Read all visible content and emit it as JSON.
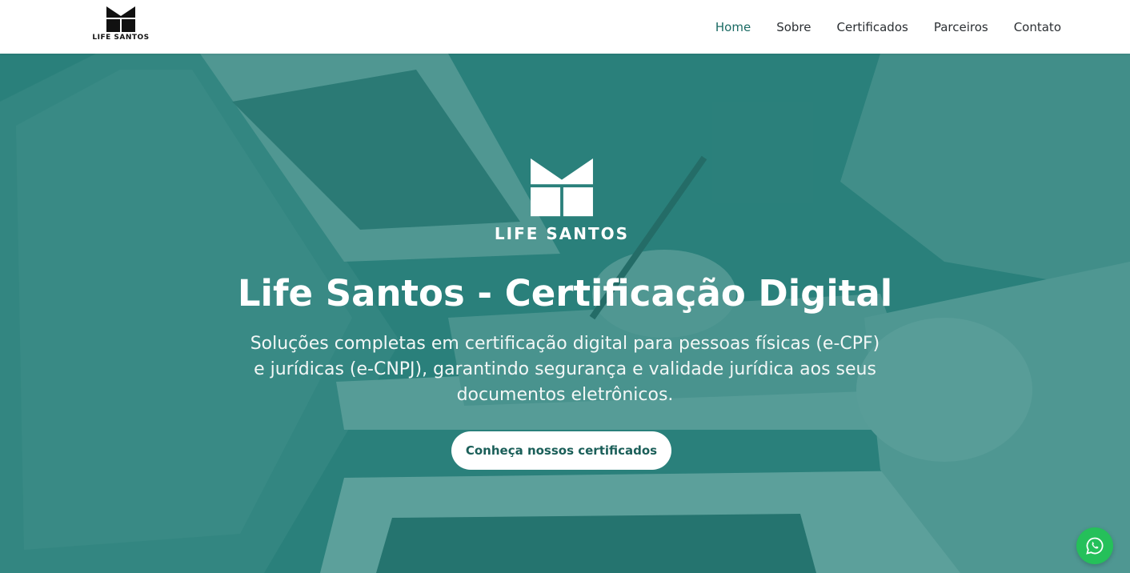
{
  "header": {
    "logo_text": "LIFE SANTOS",
    "nav": [
      {
        "label": "Home",
        "active": true
      },
      {
        "label": "Sobre",
        "active": false
      },
      {
        "label": "Certificados",
        "active": false
      },
      {
        "label": "Parceiros",
        "active": false
      },
      {
        "label": "Contato",
        "active": false
      }
    ]
  },
  "hero": {
    "logo_text": "LIFE SANTOS",
    "title": "Life Santos - Certificação Digital",
    "subtitle": "Soluções completas em certificação digital para pessoas físicas (e-CPF) e jurídicas (e-CNPJ), garantindo segurança e validade jurídica aos seus documentos eletrônicos.",
    "cta_label": "Conheça nossos certificados"
  },
  "floating": {
    "whatsapp_icon": "whatsapp-icon"
  },
  "colors": {
    "brand_teal": "#1b6b64",
    "hero_overlay": "#2e7f7a",
    "whatsapp_green": "#25c05a"
  }
}
